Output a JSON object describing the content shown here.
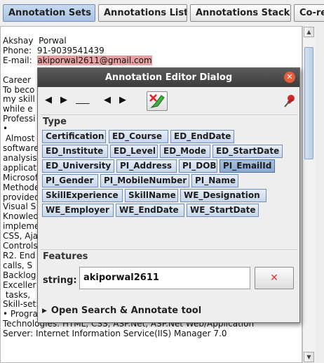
{
  "tabs": [
    {
      "label": "Annotation Sets",
      "selected": true
    },
    {
      "label": "Annotations List",
      "selected": false
    },
    {
      "label": "Annotations Stack",
      "selected": false
    },
    {
      "label": "Co-ref",
      "selected": false
    }
  ],
  "document": {
    "lines": [
      "Akshay  Porwal",
      "Phone:  91-9039541439",
      "E-mail:  ",
      "",
      "Career",
      "To beco",
      "my skill",
      "while e",
      "Professi",
      "•",
      " Almost",
      "software",
      "analysis",
      "applicat",
      "Microsof",
      "Methode",
      "provided",
      "Visual S",
      "Knowled",
      "impleme",
      "CSS, Aja",
      "Controls",
      "R2. End",
      "calls, S",
      "Backlog",
      "Exceller",
      " tasks,",
      "Skill-set:",
      "• Programming Language: C/C++,  VB.NET,  C#.NET",
      "Technologies: HTML, CSS, ASP.Net, ASP.Net Web/Application",
      "Server: Internet Information Service(IIS) Manager 7.0"
    ],
    "email_highlighted": "akiporwal2611@gmail.com"
  },
  "dialog": {
    "title": "Annotation Editor Dialog",
    "type_label": "Type",
    "types": [
      "Certification",
      "ED_Course",
      "ED_EndDate",
      "ED_Institute",
      "ED_Level",
      "ED_Mode",
      "ED_StartDate",
      "ED_University",
      "PI_Address",
      "PI_DOB",
      "PI_EmailId",
      "PI_Gender",
      "PI_MobileNumber",
      "PI_Name",
      "SkillExperience",
      "SkillName",
      "WE_Designation",
      "WE_Employer",
      "WE_EndDate",
      "WE_StartDate"
    ],
    "selected_type": "PI_EmailId",
    "features_label": "Features",
    "feature_key": "string:",
    "feature_value": "akiporwal2611",
    "delete_glyph": "✕",
    "expander_label": "Open Search & Annotate tool",
    "nav_dashes": "___"
  },
  "icons": {
    "close": "close-icon",
    "edit": "edit-annotation-icon",
    "pin": "pushpin-icon"
  },
  "colors": {
    "email_highlight": "#e8a0a0",
    "selected_tab": "#a9c2e3",
    "type_chip": "#c7d6ea",
    "dialog_titlebar": "#3c3c3c"
  }
}
